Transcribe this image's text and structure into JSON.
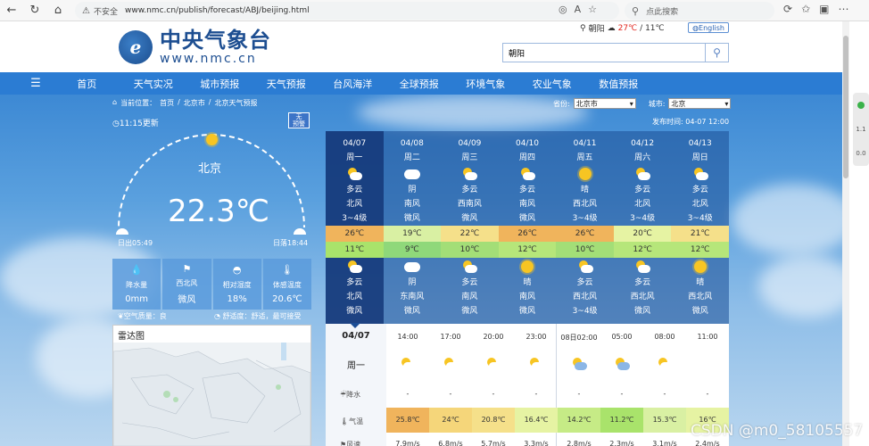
{
  "browser": {
    "insecure_label": "不安全",
    "url": "www.nmc.cn/publish/forecast/ABJ/beijing.html",
    "search_placeholder": "点此搜索"
  },
  "header": {
    "logo_cn": "中央气象台",
    "logo_en": "www.nmc.cn",
    "weather_city": "朝阳",
    "weather_high": "27℃",
    "weather_low": "/ 11℃",
    "lang_button": "English",
    "search_value": "朝阳"
  },
  "nav": {
    "items": [
      "首页",
      "天气实况",
      "城市预报",
      "天气预报",
      "台风海洋",
      "全球预报",
      "环境气象",
      "农业气象",
      "数值预报"
    ]
  },
  "crumb": {
    "prefix": "当前位置：",
    "items": [
      "首页",
      "/",
      "北京市",
      "/",
      "北京天气预报"
    ]
  },
  "selectors": {
    "province_label": "省份:",
    "province_value": "北京市",
    "city_label": "城市:",
    "city_value": "北京"
  },
  "current": {
    "update_time": "11:15更新",
    "publish_time": "发布时间:  04-07 12:00",
    "alarm_badge": "无\n预警",
    "city": "北京",
    "temperature": "22.3℃",
    "sunrise": "日出05:49",
    "sunset": "日落18:44",
    "metrics": [
      {
        "label": "降水量",
        "value": "0mm"
      },
      {
        "label": "西北风",
        "value": "微风"
      },
      {
        "label": "相对湿度",
        "value": "18%"
      },
      {
        "label": "体感温度",
        "value": "20.6℃"
      }
    ],
    "air_quality": "空气质量：良",
    "comfort": "舒适度：舒适，最可接受"
  },
  "radar": {
    "title": "雷达图"
  },
  "forecast": {
    "days": [
      {
        "date": "04/07",
        "week": "周一",
        "day_icon": "partly-cloudy",
        "day_weather": "多云",
        "day_wind_dir": "北风",
        "day_wind": "3~4级",
        "high": "26℃",
        "low": "11℃",
        "night_icon": "partly-cloudy",
        "night_weather": "多云",
        "night_wind_dir": "北风",
        "night_wind": "微风",
        "high_color": "#f0b45c",
        "low_color": "#a9e36b"
      },
      {
        "date": "04/08",
        "week": "周二",
        "day_icon": "cloudy",
        "day_weather": "阴",
        "day_wind_dir": "南风",
        "day_wind": "微风",
        "high": "19℃",
        "low": "9℃",
        "night_icon": "cloudy",
        "night_weather": "阴",
        "night_wind_dir": "东南风",
        "night_wind": "微风",
        "high_color": "#d9f0a3",
        "low_color": "#8fd87a"
      },
      {
        "date": "04/09",
        "week": "周三",
        "day_icon": "partly-cloudy",
        "day_weather": "多云",
        "day_wind_dir": "西南风",
        "day_wind": "微风",
        "high": "22℃",
        "low": "10℃",
        "night_icon": "partly-cloudy",
        "night_weather": "多云",
        "night_wind_dir": "南风",
        "night_wind": "微风",
        "high_color": "#f5e08a",
        "low_color": "#a3de77"
      },
      {
        "date": "04/10",
        "week": "周四",
        "day_icon": "partly-cloudy",
        "day_weather": "多云",
        "day_wind_dir": "南风",
        "day_wind": "微风",
        "high": "26℃",
        "low": "12℃",
        "night_icon": "sunny",
        "night_weather": "晴",
        "night_wind_dir": "南风",
        "night_wind": "微风",
        "high_color": "#f0b45c",
        "low_color": "#b6e67a"
      },
      {
        "date": "04/11",
        "week": "周五",
        "day_icon": "sunny",
        "day_weather": "晴",
        "day_wind_dir": "西北风",
        "day_wind": "3~4级",
        "high": "26℃",
        "low": "10℃",
        "night_icon": "partly-cloudy",
        "night_weather": "多云",
        "night_wind_dir": "西北风",
        "night_wind": "3~4级",
        "high_color": "#f0b45c",
        "low_color": "#a3de77"
      },
      {
        "date": "04/12",
        "week": "周六",
        "day_icon": "partly-cloudy",
        "day_weather": "多云",
        "day_wind_dir": "北风",
        "day_wind": "3~4级",
        "high": "20℃",
        "low": "12℃",
        "night_icon": "partly-cloudy",
        "night_weather": "多云",
        "night_wind_dir": "西北风",
        "night_wind": "微风",
        "high_color": "#e6f3a3",
        "low_color": "#b6e67a"
      },
      {
        "date": "04/13",
        "week": "周日",
        "day_icon": "partly-cloudy",
        "day_weather": "多云",
        "day_wind_dir": "北风",
        "day_wind": "3~4级",
        "high": "21℃",
        "low": "12℃",
        "night_icon": "sunny",
        "night_weather": "晴",
        "night_wind_dir": "西北风",
        "night_wind": "微风",
        "high_color": "#f5e08a",
        "low_color": "#b6e67a"
      }
    ]
  },
  "hourly": {
    "date": "04/07",
    "week": "周一",
    "precip_label": "降水",
    "temp_label": "气温",
    "wind_label": "风速",
    "hours": [
      {
        "time": "14:00",
        "icon": "partly-cloudy",
        "precip": "-",
        "temp": "25.8℃",
        "wind": "7.9m/s",
        "color": "#f0b45c"
      },
      {
        "time": "17:00",
        "icon": "partly-cloudy",
        "precip": "-",
        "temp": "24℃",
        "wind": "6.8m/s",
        "color": "#f5d67a"
      },
      {
        "time": "20:00",
        "icon": "partly-cloudy",
        "precip": "-",
        "temp": "20.8℃",
        "wind": "5.7m/s",
        "color": "#f5e08a"
      },
      {
        "time": "23:00",
        "icon": "partly-cloudy",
        "precip": "-",
        "temp": "16.4℃",
        "wind": "3.3m/s",
        "color": "#e6f3a3"
      },
      {
        "time": "08日02:00",
        "icon": "partly-cloudy-night",
        "precip": "-",
        "temp": "14.2℃",
        "wind": "2.8m/s",
        "color": "#c6eb86"
      },
      {
        "time": "05:00",
        "icon": "partly-cloudy-night",
        "precip": "-",
        "temp": "11.2℃",
        "wind": "2.3m/s",
        "color": "#a9e36b"
      },
      {
        "time": "08:00",
        "icon": "partly-cloudy",
        "precip": "-",
        "temp": "15.3℃",
        "wind": "3.1m/s",
        "color": "#d9f0a3"
      },
      {
        "time": "11:00",
        "icon": "cloudy",
        "precip": "-",
        "temp": "16℃",
        "wind": "2.4m/s",
        "color": "#e6f3a3"
      }
    ]
  },
  "side": {
    "labels": [
      "1.1",
      "0.0"
    ]
  },
  "watermark": "CSDN @m0_58105557"
}
